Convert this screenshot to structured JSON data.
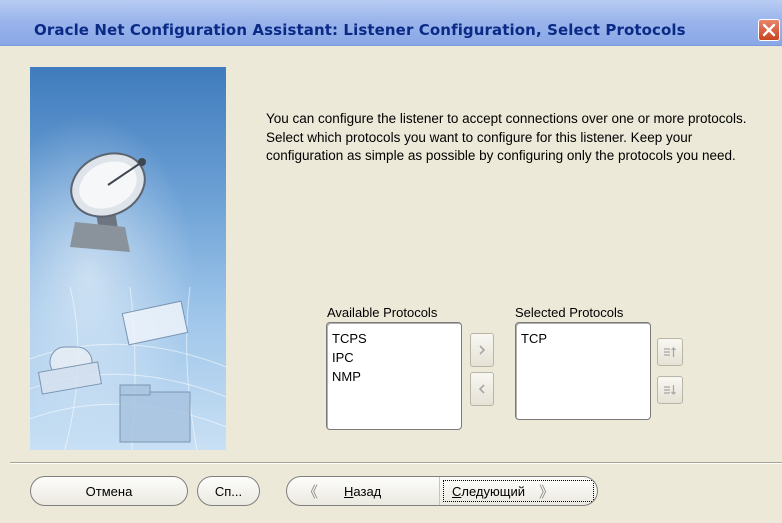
{
  "window": {
    "title": "Oracle Net Configuration Assistant: Listener Configuration, Select Protocols"
  },
  "main": {
    "description": "You can configure the listener to accept connections over one or more protocols. Select which protocols you want to configure for this listener. Keep your configuration as simple as possible by configuring only the protocols you need."
  },
  "protocols": {
    "available_label": "Available Protocols",
    "available": [
      "TCPS",
      "IPC",
      "NMP"
    ],
    "selected_label": "Selected Protocols",
    "selected": [
      "TCP"
    ]
  },
  "buttons": {
    "cancel": "Отмена",
    "help": "Сп...",
    "back_mnemonic": "Н",
    "back_rest": "азад",
    "next_mnemonic": "С",
    "next_rest": "ледующий"
  },
  "icons": {
    "close": "close-icon",
    "move_right": "arrow-right-icon",
    "move_left": "arrow-left-icon",
    "move_up": "move-up-icon",
    "move_down": "move-down-icon",
    "back": "chevron-left-icon",
    "next": "chevron-right-icon"
  },
  "colors": {
    "titlebar": "#9bb5ec",
    "title_text": "#0b2a86",
    "close_button": "#c9431f",
    "dialog_bg": "#ece9d8"
  }
}
